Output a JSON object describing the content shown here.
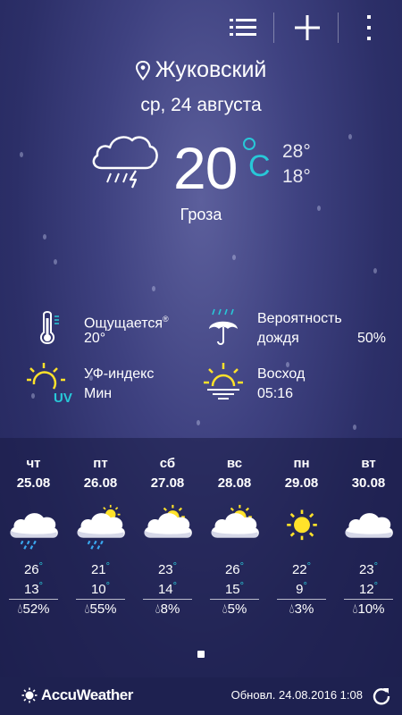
{
  "header": {
    "list_icon": "list-icon",
    "add_icon": "plus-icon",
    "menu_icon": "more-vert-icon"
  },
  "location": {
    "city": "Жуковский",
    "pin_icon": "location-pin-icon"
  },
  "date": "ср, 24 августа",
  "current": {
    "icon": "thunderstorm-icon",
    "temperature": "20",
    "unit": "C",
    "high": "28°",
    "low": "18°",
    "condition": "Гроза"
  },
  "details": {
    "feels_like": {
      "label": "Ощущается",
      "mark": "®",
      "value": "20°",
      "icon": "thermometer-icon"
    },
    "rain_chance": {
      "label_line1": "Вероятность",
      "label_line2": "дождя",
      "value": "50%",
      "icon": "umbrella-icon"
    },
    "uv": {
      "label": "УФ-индекс",
      "value": "Мин",
      "badge": "UV",
      "icon": "uv-icon"
    },
    "sunrise": {
      "label": "Восход",
      "value": "05:16",
      "icon": "sunrise-icon"
    }
  },
  "forecast": [
    {
      "day": "чт",
      "date": "25.08",
      "icon": "rain-cloud-icon",
      "high": "26",
      "low": "13",
      "precip": "52%"
    },
    {
      "day": "пт",
      "date": "26.08",
      "icon": "sun-rain-cloud-icon",
      "high": "21",
      "low": "10",
      "precip": "55%"
    },
    {
      "day": "сб",
      "date": "27.08",
      "icon": "partly-cloudy-icon",
      "high": "23",
      "low": "14",
      "precip": "8%"
    },
    {
      "day": "вс",
      "date": "28.08",
      "icon": "partly-cloudy-icon",
      "high": "26",
      "low": "15",
      "precip": "5%"
    },
    {
      "day": "пн",
      "date": "29.08",
      "icon": "sunny-icon",
      "high": "22",
      "low": "9",
      "precip": "3%"
    },
    {
      "day": "вт",
      "date": "30.08",
      "icon": "cloudy-icon",
      "high": "23",
      "low": "12",
      "precip": "10%"
    }
  ],
  "footer": {
    "brand": "AccuWeather",
    "updated": "Обновл. 24.08.2016 1:08",
    "refresh_icon": "refresh-icon"
  },
  "colors": {
    "accent": "#28c8d8",
    "sun": "#ffe22a",
    "rain": "#3aa8f0"
  }
}
